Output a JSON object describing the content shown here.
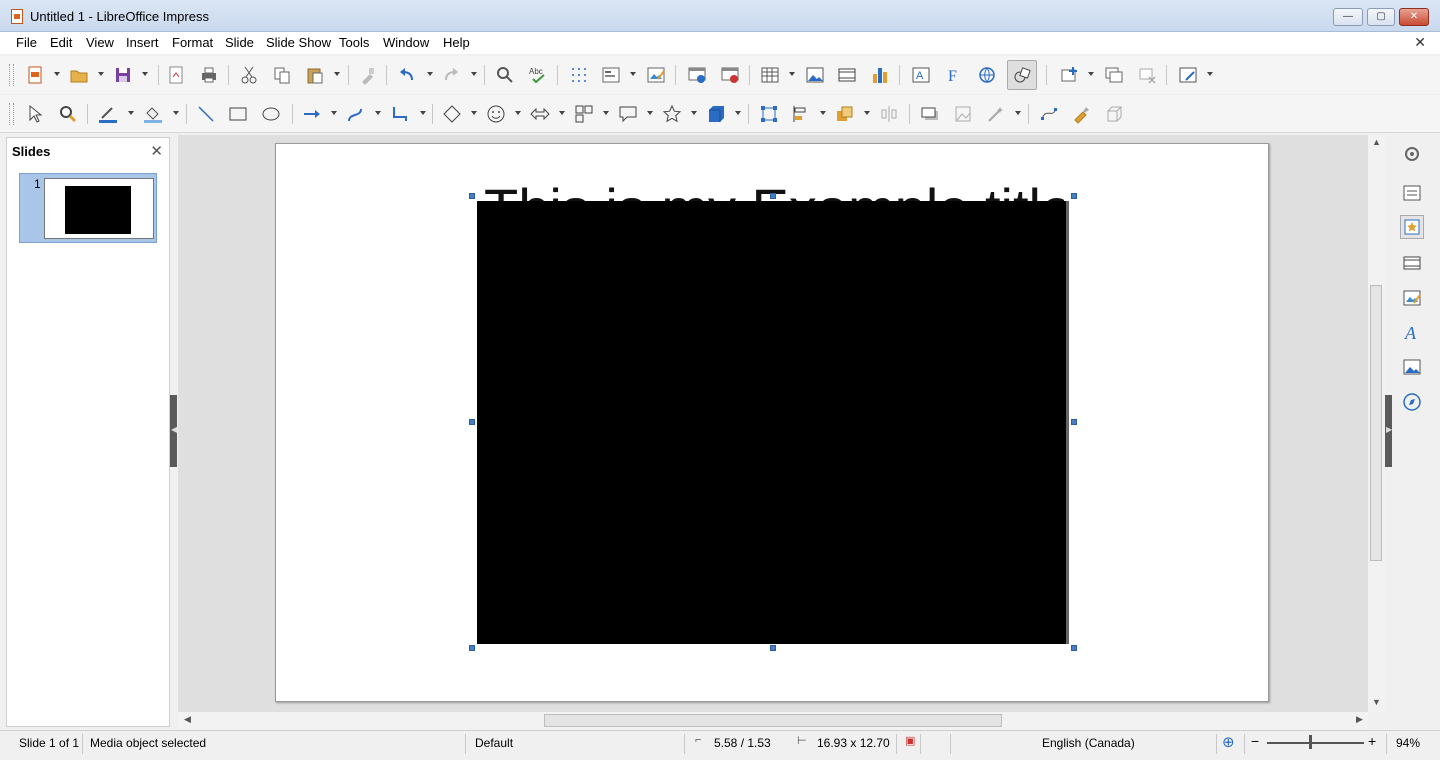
{
  "window": {
    "title": "Untitled 1 - LibreOffice Impress",
    "minimize": "—",
    "maximize": "▢",
    "close": "✕"
  },
  "menu": [
    "File",
    "Edit",
    "View",
    "Insert",
    "Format",
    "Slide",
    "Slide Show",
    "Tools",
    "Window",
    "Help"
  ],
  "menu_close": "✕",
  "slides_pane": {
    "title": "Slides",
    "close": "✕",
    "slide_number": "1"
  },
  "slide": {
    "title_text": "This is my Example title"
  },
  "statusbar": {
    "slide": "Slide 1 of 1",
    "selection": "Media object selected",
    "master": "Default",
    "position": "5.58 / 1.53",
    "size": "16.93 x 12.70",
    "language": "English (Canada)",
    "zoom_minus": "−",
    "zoom_plus": "+",
    "zoom": "94%"
  },
  "colors": {
    "accent": "#4a7fbf",
    "selection_handle": "#4a7fbf",
    "slide_thumb_bg": "#a9c5e8"
  }
}
